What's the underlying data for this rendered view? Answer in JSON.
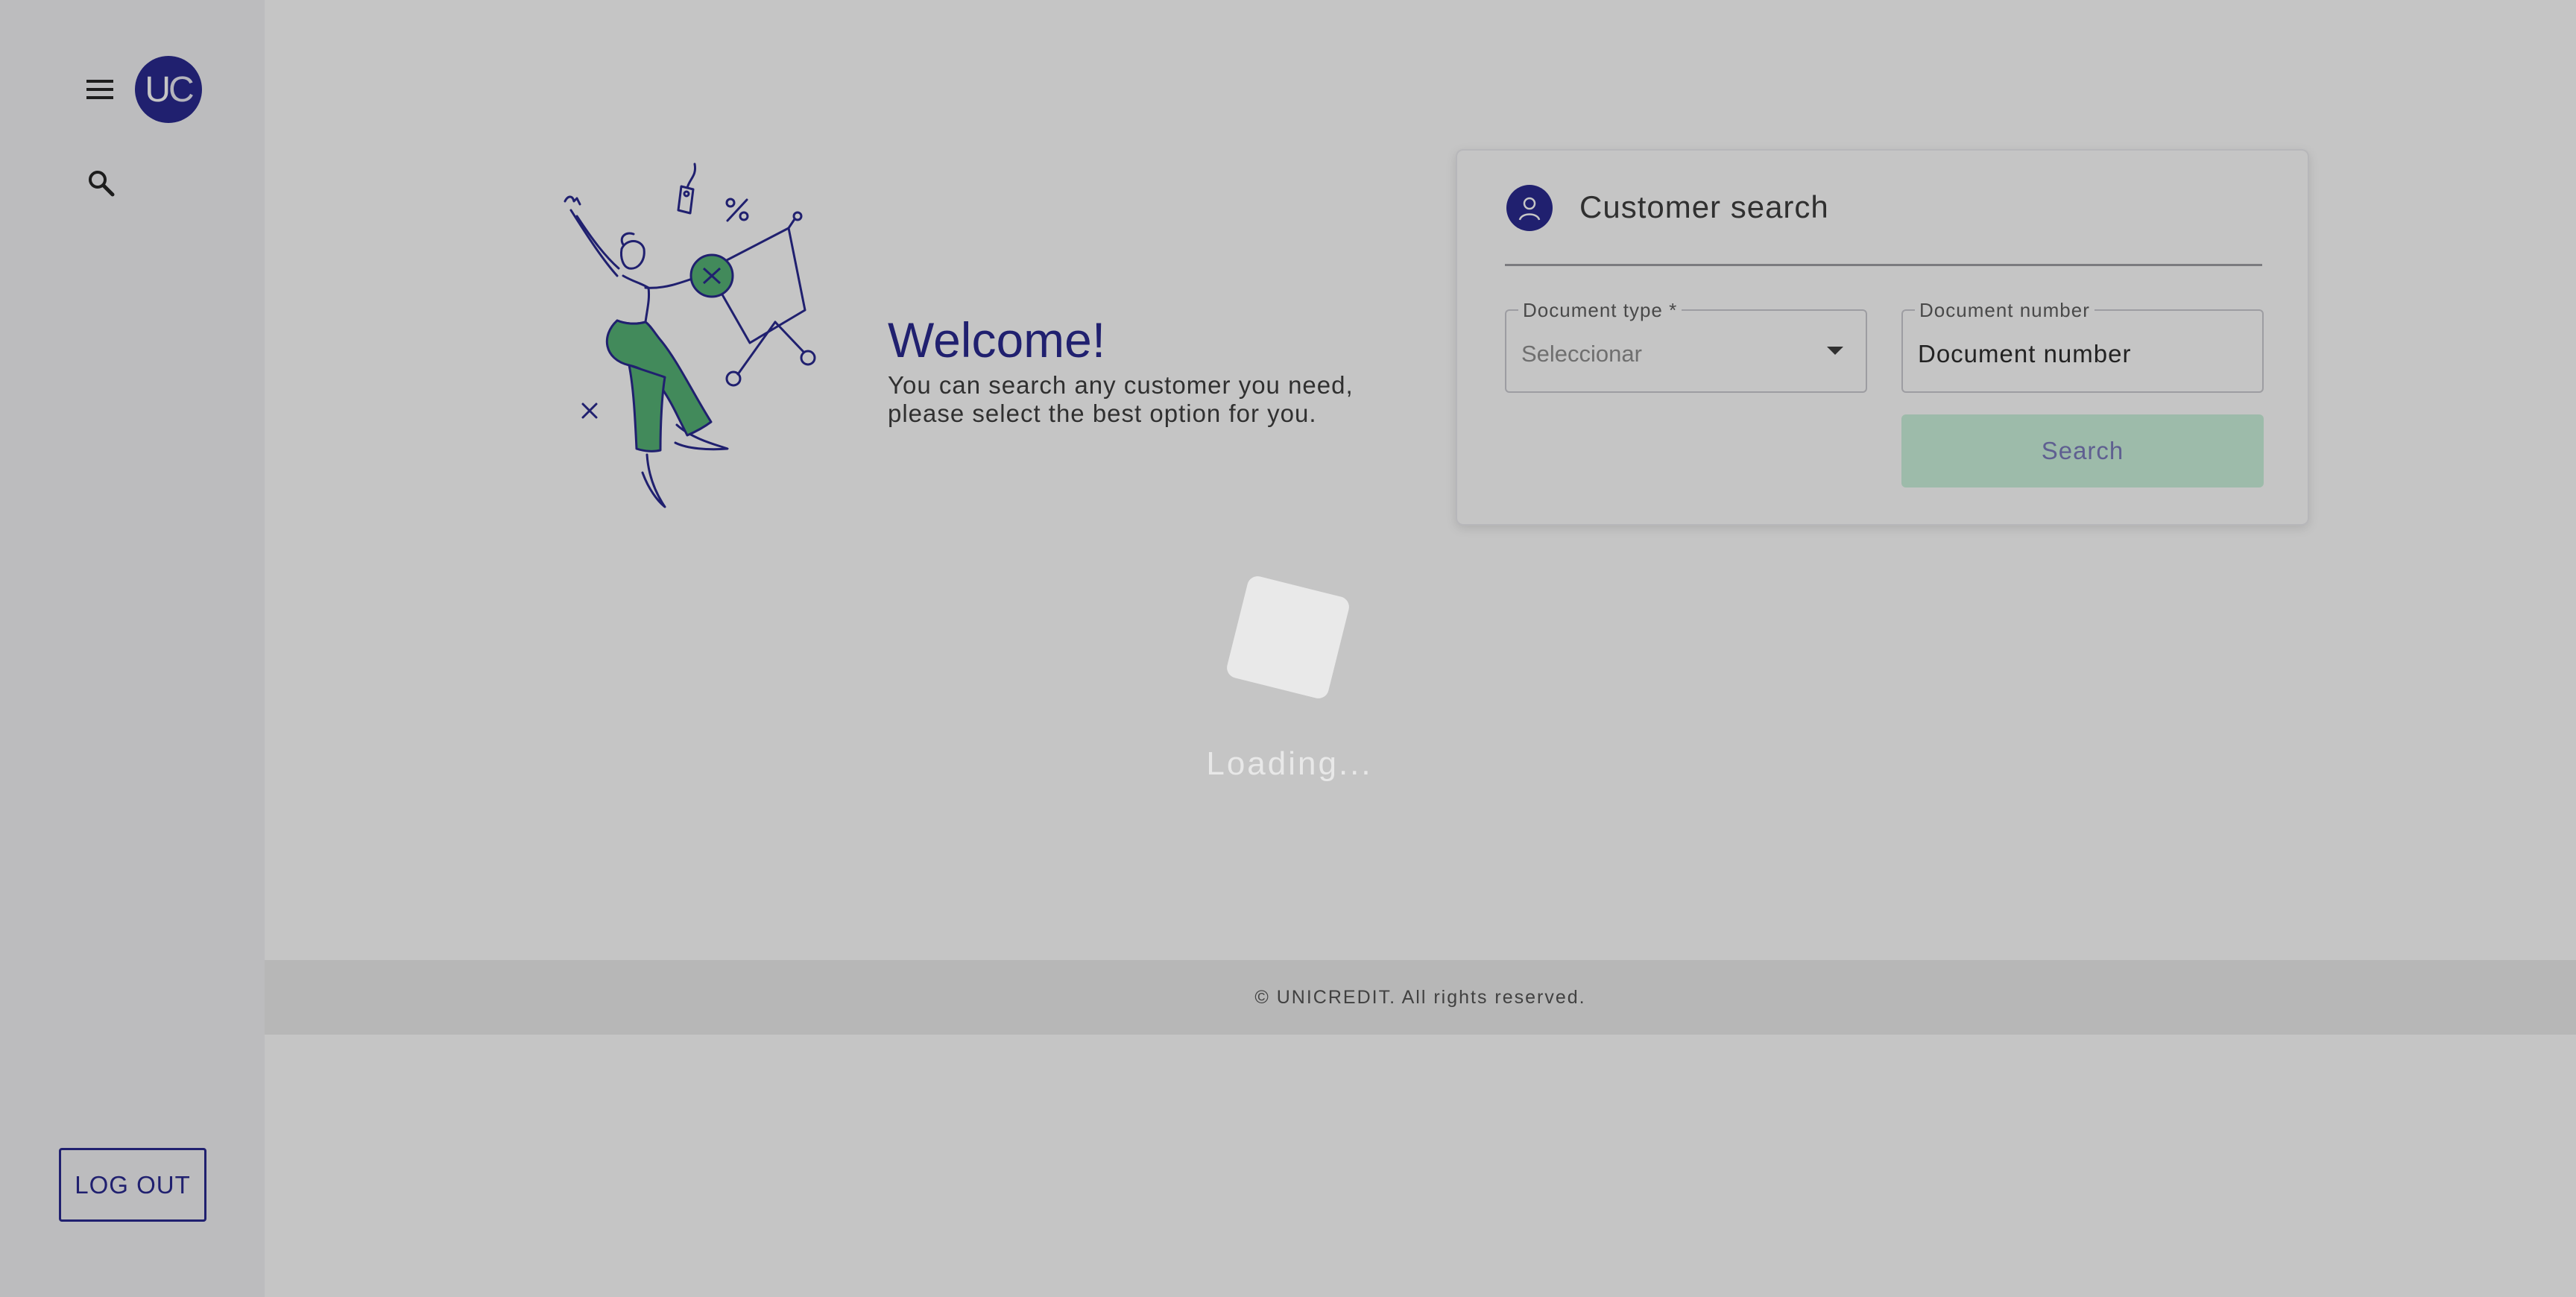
{
  "sidebar": {
    "avatar_initials_1": "U",
    "avatar_initials_2": "C",
    "logout_label": "LOG OUT"
  },
  "welcome": {
    "title": "Welcome!",
    "subtitle": "You can search any customer you need, please select the best option for you."
  },
  "customer_search": {
    "title": "Customer search",
    "document_type": {
      "label": "Document type *",
      "selected_value": "Seleccionar"
    },
    "document_number": {
      "label": "Document number",
      "placeholder": "Document number"
    },
    "search_label": "Search"
  },
  "footer": {
    "copyright": "© UNICREDIT. All rights reserved."
  },
  "loading": {
    "text": "Loading..."
  },
  "icons": {
    "menu": "menu-icon",
    "search": "search-icon",
    "user": "user-icon",
    "dropdown": "chevron-down-icon"
  },
  "colors": {
    "brand": "#1d1d8a",
    "accent_green": "#4caf6e",
    "search_button_disabled": "#c9f2da"
  }
}
